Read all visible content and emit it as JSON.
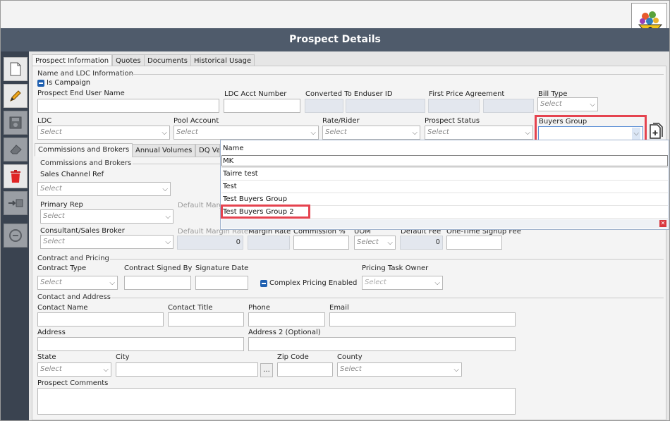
{
  "window": {
    "title": "Prospect Details"
  },
  "tabs": [
    "Prospect Information",
    "Quotes",
    "Documents",
    "Historical Usage"
  ],
  "sub_tabs": [
    "Commissions and Brokers",
    "Annual Volumes",
    "DQ Va"
  ],
  "name_ldc": {
    "section": "Name and LDC Information",
    "is_campaign": "Is Campaign",
    "end_user_name": "Prospect End User Name",
    "ldc_acct": "LDC Acct Number",
    "converted": "Converted To Enduser ID",
    "first_price": "First Price Agreement",
    "bill_type": "Bill Type",
    "ldc": "LDC",
    "pool_account": "Pool Account",
    "rate_rider": "Rate/Rider",
    "prospect_status": "Prospect Status",
    "buyers_group": "Buyers Group"
  },
  "select_placeholder": "Select",
  "commissions": {
    "section": "Commissions and Brokers",
    "sales_channel_ref": "Sales Channel Ref",
    "primary_rep": "Primary Rep",
    "default_margin": "Default Marg",
    "consultant": "Consultant/Sales Broker",
    "default_margin_rate": "Default Margin Rate",
    "margin_rate": "Margin Rate",
    "commission_pct": "Commission %",
    "uom": "UOM",
    "default_fee": "Default Fee",
    "one_time_fee": "One-Time Signup Fee",
    "val_zero": "0"
  },
  "contract": {
    "section": "Contract and Pricing",
    "contract_type": "Contract Type",
    "contract_signed_by": "Contract Signed By",
    "signature_date": "Signature Date",
    "complex_pricing": "Complex Pricing Enabled",
    "pricing_task_owner": "Pricing Task Owner"
  },
  "contact": {
    "section": "Contact and Address",
    "contact_name": "Contact Name",
    "contact_title": "Contact Title",
    "phone": "Phone",
    "email": "Email",
    "address": "Address",
    "address2": "Address 2 (Optional)",
    "state": "State",
    "city": "City",
    "city_btn": "...",
    "zip": "Zip Code",
    "county": "County",
    "comments": "Prospect Comments"
  },
  "buyers_dropdown": {
    "header": "Name",
    "items": [
      "MK",
      "Tairre test",
      "Test",
      "Test Buyers Group",
      "Test Buyers Group 2"
    ]
  },
  "colors": {
    "titlebar": "#4f5b6b",
    "sidebar": "#3a4350",
    "highlight": "#e5434f",
    "checkbox": "#1e5fb0"
  },
  "icons": [
    "new-document-icon",
    "edit-pencil-icon",
    "save-disk-icon",
    "eraser-icon",
    "delete-trash-icon",
    "transfer-icon",
    "disabled-circle-icon",
    "add-document-icon",
    "logo-icon"
  ]
}
